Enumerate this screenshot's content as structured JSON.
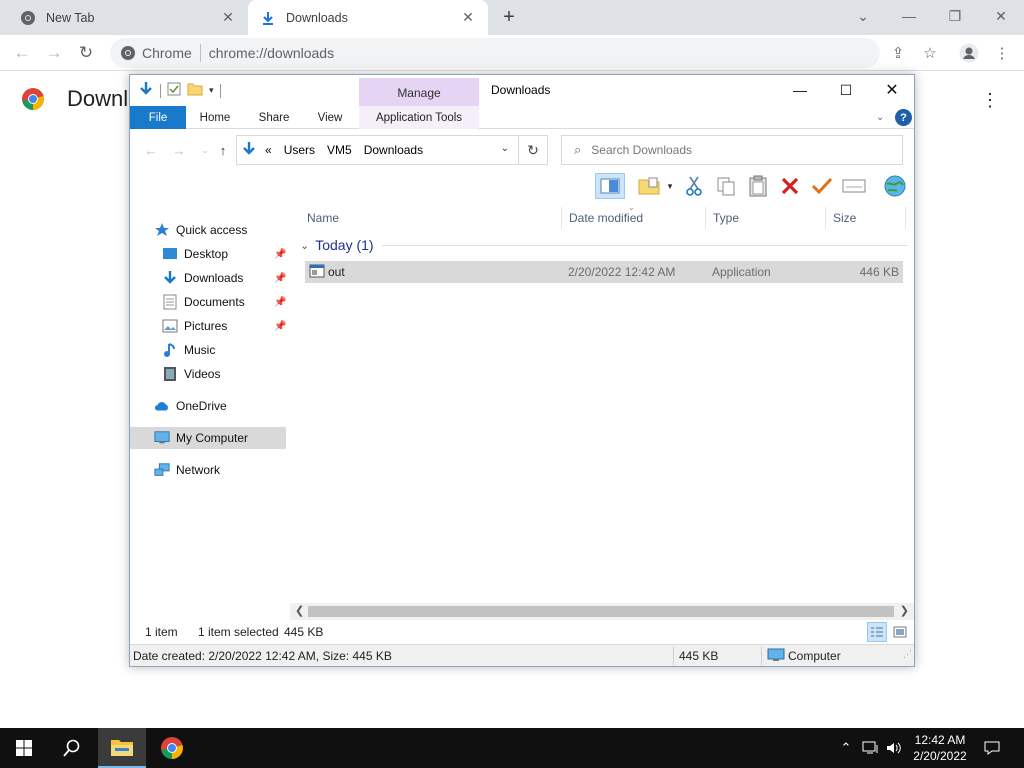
{
  "chrome": {
    "tabs": [
      {
        "title": "New Tab",
        "icon": "chrome-icon"
      },
      {
        "title": "Downloads",
        "icon": "download-icon"
      }
    ],
    "omnibox": {
      "chip": "Chrome",
      "url": "chrome://downloads"
    },
    "page_title": "Downl"
  },
  "explorer": {
    "title": "Downloads",
    "manage_label": "Manage",
    "ribbon_tabs": [
      "File",
      "Home",
      "Share",
      "View",
      "Application Tools"
    ],
    "breadcrumb": {
      "prefix": "«",
      "items": [
        "Users",
        "VM5",
        "Downloads"
      ]
    },
    "search_placeholder": "Search Downloads",
    "nav": {
      "quick_access": "Quick access",
      "items": [
        "Desktop",
        "Downloads",
        "Documents",
        "Pictures",
        "Music",
        "Videos"
      ],
      "onedrive": "OneDrive",
      "my_computer": "My Computer",
      "network": "Network"
    },
    "columns": [
      "Name",
      "Date modified",
      "Type",
      "Size"
    ],
    "group": "Today (1)",
    "files": [
      {
        "name": "out",
        "date": "2/20/2022 12:42 AM",
        "type": "Application",
        "size": "446 KB"
      }
    ],
    "status": {
      "count": "1 item",
      "selected": "1 item selected",
      "selected_size": "445 KB"
    },
    "details": {
      "info": "Date created: 2/20/2022 12:42 AM, Size: 445 KB",
      "size": "445 KB",
      "location": "Computer"
    }
  },
  "taskbar": {
    "time": "12:42 AM",
    "date": "2/20/2022"
  },
  "colors": {
    "file_tab": "#1979ca",
    "manage_tab": "#e6d4f5",
    "taskbar": "#101010",
    "selection": "#d9d9d9"
  }
}
